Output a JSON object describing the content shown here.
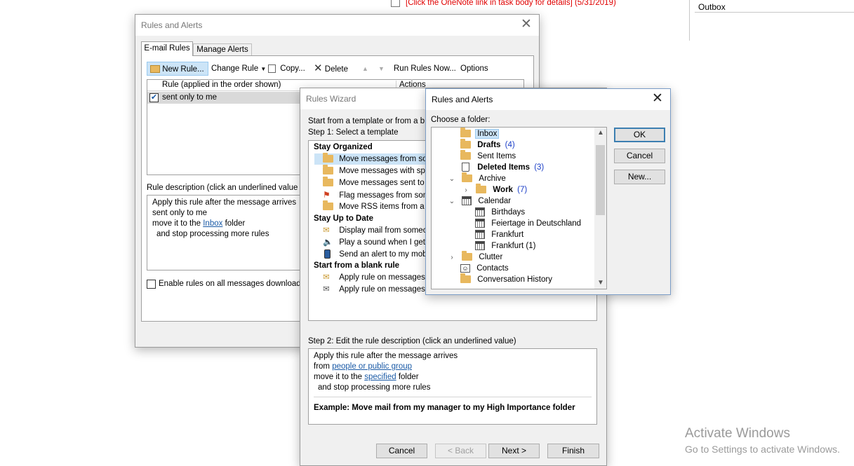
{
  "background": {
    "task_text": "[Click the OneNote link in task body for details]  (5/31/2019)",
    "outbox_label": "Outbox",
    "watermark_title": "Activate Windows",
    "watermark_sub": "Go to Settings to activate Windows."
  },
  "rules_dialog": {
    "title": "Rules and Alerts",
    "tabs": [
      "E-mail Rules",
      "Manage Alerts"
    ],
    "toolbar": {
      "new_rule": "New Rule...",
      "change_rule": "Change Rule",
      "copy": "Copy...",
      "delete": "Delete",
      "run_rules_now": "Run Rules Now...",
      "options": "Options"
    },
    "list_header_rule": "Rule (applied in the order shown)",
    "list_header_actions": "Actions",
    "rules": [
      {
        "name": "sent only to me",
        "checked": true
      }
    ],
    "description_label": "Rule description (click an underlined value",
    "description": {
      "line1": "Apply this rule after the message arrives",
      "line2": "sent only to me",
      "line3_pre": "move it to the ",
      "line3_link": "Inbox",
      "line3_post": " folder",
      "line4": "and stop processing more rules"
    },
    "enable_all_label": "Enable rules on all messages download"
  },
  "wizard": {
    "title": "Rules Wizard",
    "intro": "Start from a template or from a b",
    "step1_label": "Step 1: Select a template",
    "sections": [
      {
        "heading": "Stay Organized",
        "items": [
          "Move messages from som",
          "Move messages with spe",
          "Move messages sent to a",
          "Flag messages from som",
          "Move RSS items from a sp"
        ]
      },
      {
        "heading": "Stay Up to Date",
        "items": [
          "Display mail from someo",
          "Play a sound when I get",
          "Send an alert to my mobi"
        ]
      },
      {
        "heading": "Start from a blank rule",
        "items": [
          "Apply rule on messages I",
          "Apply rule on messages I"
        ]
      }
    ],
    "step2_label": "Step 2: Edit the rule description (click an underlined value)",
    "desc": {
      "line1": "Apply this rule after the message arrives",
      "line2_pre": "from ",
      "line2_link": "people or public group",
      "line3_pre": "move it to the ",
      "line3_link": "specified",
      "line3_post": " folder",
      "line4": "and stop processing more rules",
      "example": "Example: Move mail from my manager to my High Importance folder"
    },
    "buttons": {
      "cancel": "Cancel",
      "back": "< Back",
      "next": "Next >",
      "finish": "Finish"
    }
  },
  "folder_dialog": {
    "title": "Rules and Alerts",
    "choose_label": "Choose a folder:",
    "folders": [
      {
        "name": "Inbox",
        "count": ""
      },
      {
        "name": "Drafts",
        "count": "(4)"
      },
      {
        "name": "Sent Items",
        "count": ""
      },
      {
        "name": "Deleted Items",
        "count": "(3)"
      },
      {
        "name": "Archive",
        "count": ""
      },
      {
        "name": "Work",
        "count": "(7)"
      },
      {
        "name": "Calendar",
        "count": ""
      },
      {
        "name": "Birthdays",
        "count": ""
      },
      {
        "name": "Feiertage in Deutschland",
        "count": ""
      },
      {
        "name": "Frankfurt",
        "count": ""
      },
      {
        "name": "Frankfurt (1)",
        "count": ""
      },
      {
        "name": "Clutter",
        "count": ""
      },
      {
        "name": "Contacts",
        "count": ""
      },
      {
        "name": "Conversation History",
        "count": ""
      }
    ],
    "buttons": {
      "ok": "OK",
      "cancel": "Cancel",
      "new": "New..."
    }
  }
}
